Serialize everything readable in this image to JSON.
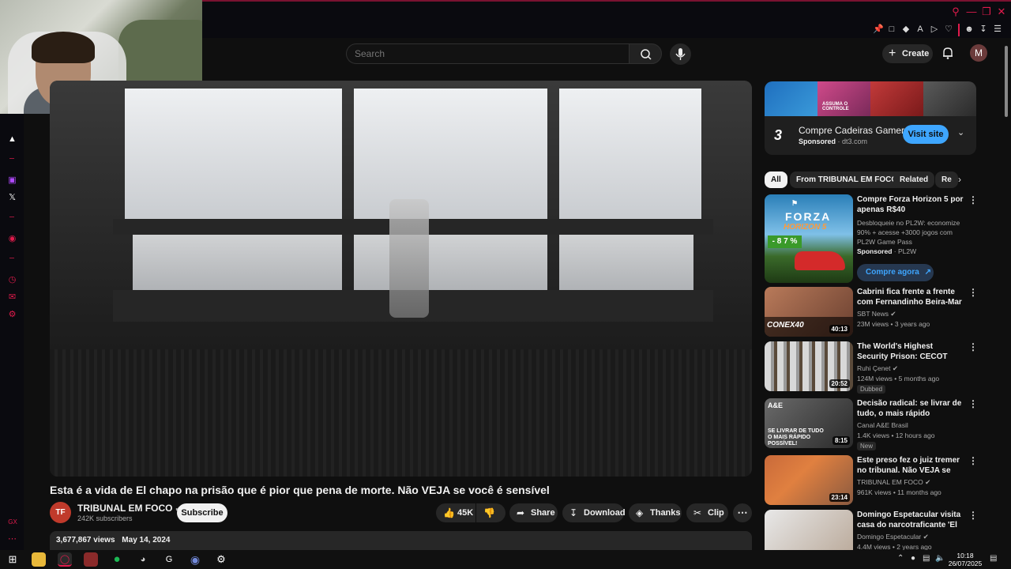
{
  "browser": {
    "window_controls": [
      "search-icon",
      "minimize-icon",
      "restore-icon",
      "close-icon"
    ],
    "toolbar_icons": [
      "pin-icon",
      "screenshot-icon",
      "shield-icon",
      "translate-icon",
      "play-icon",
      "heart-icon",
      "account-icon",
      "download-icon",
      "menu-icon"
    ]
  },
  "dock": {
    "icons": [
      "altcha-icon",
      "twitch-icon",
      "x-icon",
      "record-icon",
      "clock-icon",
      "chat-icon",
      "settings-icon"
    ],
    "bottom_label": "GX"
  },
  "masthead": {
    "search_placeholder": "Search",
    "create_label": "Create",
    "avatar_letter": "M"
  },
  "video": {
    "title": "Esta é a vida de El chapo na prisão que é pior que pena de morte. Não VEJA se você é sensível",
    "channel": "TRIBUNAL EM FOCO",
    "subscribers": "242K subscribers",
    "subscribe_label": "Subscribe",
    "likes": "45K",
    "share_label": "Share",
    "download_label": "Download",
    "thanks_label": "Thanks",
    "clip_label": "Clip",
    "views": "3,677,867 views",
    "date": "May 14, 2024"
  },
  "ad": {
    "title": "Compre Cadeiras Gamer",
    "sponsored": "Sponsored",
    "domain": "dt3.com",
    "visit_label": "Visit site",
    "banner_text": "ASSUMA O CONTROLE"
  },
  "chips": [
    "All",
    "From TRIBUNAL EM FOCO",
    "Related",
    "Re"
  ],
  "recommendations": [
    {
      "title": "Compre Forza Horizon 5 por apenas R$40",
      "line1": "Desbloqueie no PL2W: economize 90% + acesse +3000 jogos com PL2W Game Pass",
      "sponsored": "Sponsored",
      "advertiser": "PL2W",
      "cta": "Compre agora",
      "thumb_brand": "FORZA",
      "thumb_sub": "HORIZON 5",
      "discount": "- 8 7 %"
    },
    {
      "title": "Cabrini fica frente a frente com Fernandinho Beira-Mar em ...",
      "channel": "SBT News",
      "stats": "23M views • 3 years ago",
      "duration": "40:13",
      "thumb_text": "CONEX40"
    },
    {
      "title": "The World's Highest Security Prison: CECOT (The most evil ...",
      "channel": "Ruhi Çenet",
      "stats": "124M views • 5 months ago",
      "duration": "20:52",
      "badge": "Dubbed"
    },
    {
      "title": "Decisão radical: se livrar de tudo, o mais rápido possível! | ...",
      "channel": "Canal A&E Brasil",
      "stats": "1.4K views • 12 hours ago",
      "duration": "8:15",
      "badge": "New",
      "thumb_text": "SE LIVRAR DE TUDO O MAIS RÁPIDO POSSÍVEL!"
    },
    {
      "title": "Este preso fez o juiz tremer no tribunal. Não VEJA se você é ...",
      "channel": "TRIBUNAL EM FOCO",
      "stats": "961K views • 11 months ago",
      "duration": "23:14"
    },
    {
      "title": "Domingo Espetacular visita casa do narcotraficante 'El ...",
      "channel": "Domingo Espetacular",
      "stats": "4.4M views • 2 years ago"
    }
  ],
  "taskbar": {
    "time": "10:18",
    "date": "26/07/2025"
  },
  "colors": {
    "accent_red": "#e01b4c",
    "yt_blue": "#3ea6ff",
    "bg": "#0f0f0f"
  }
}
